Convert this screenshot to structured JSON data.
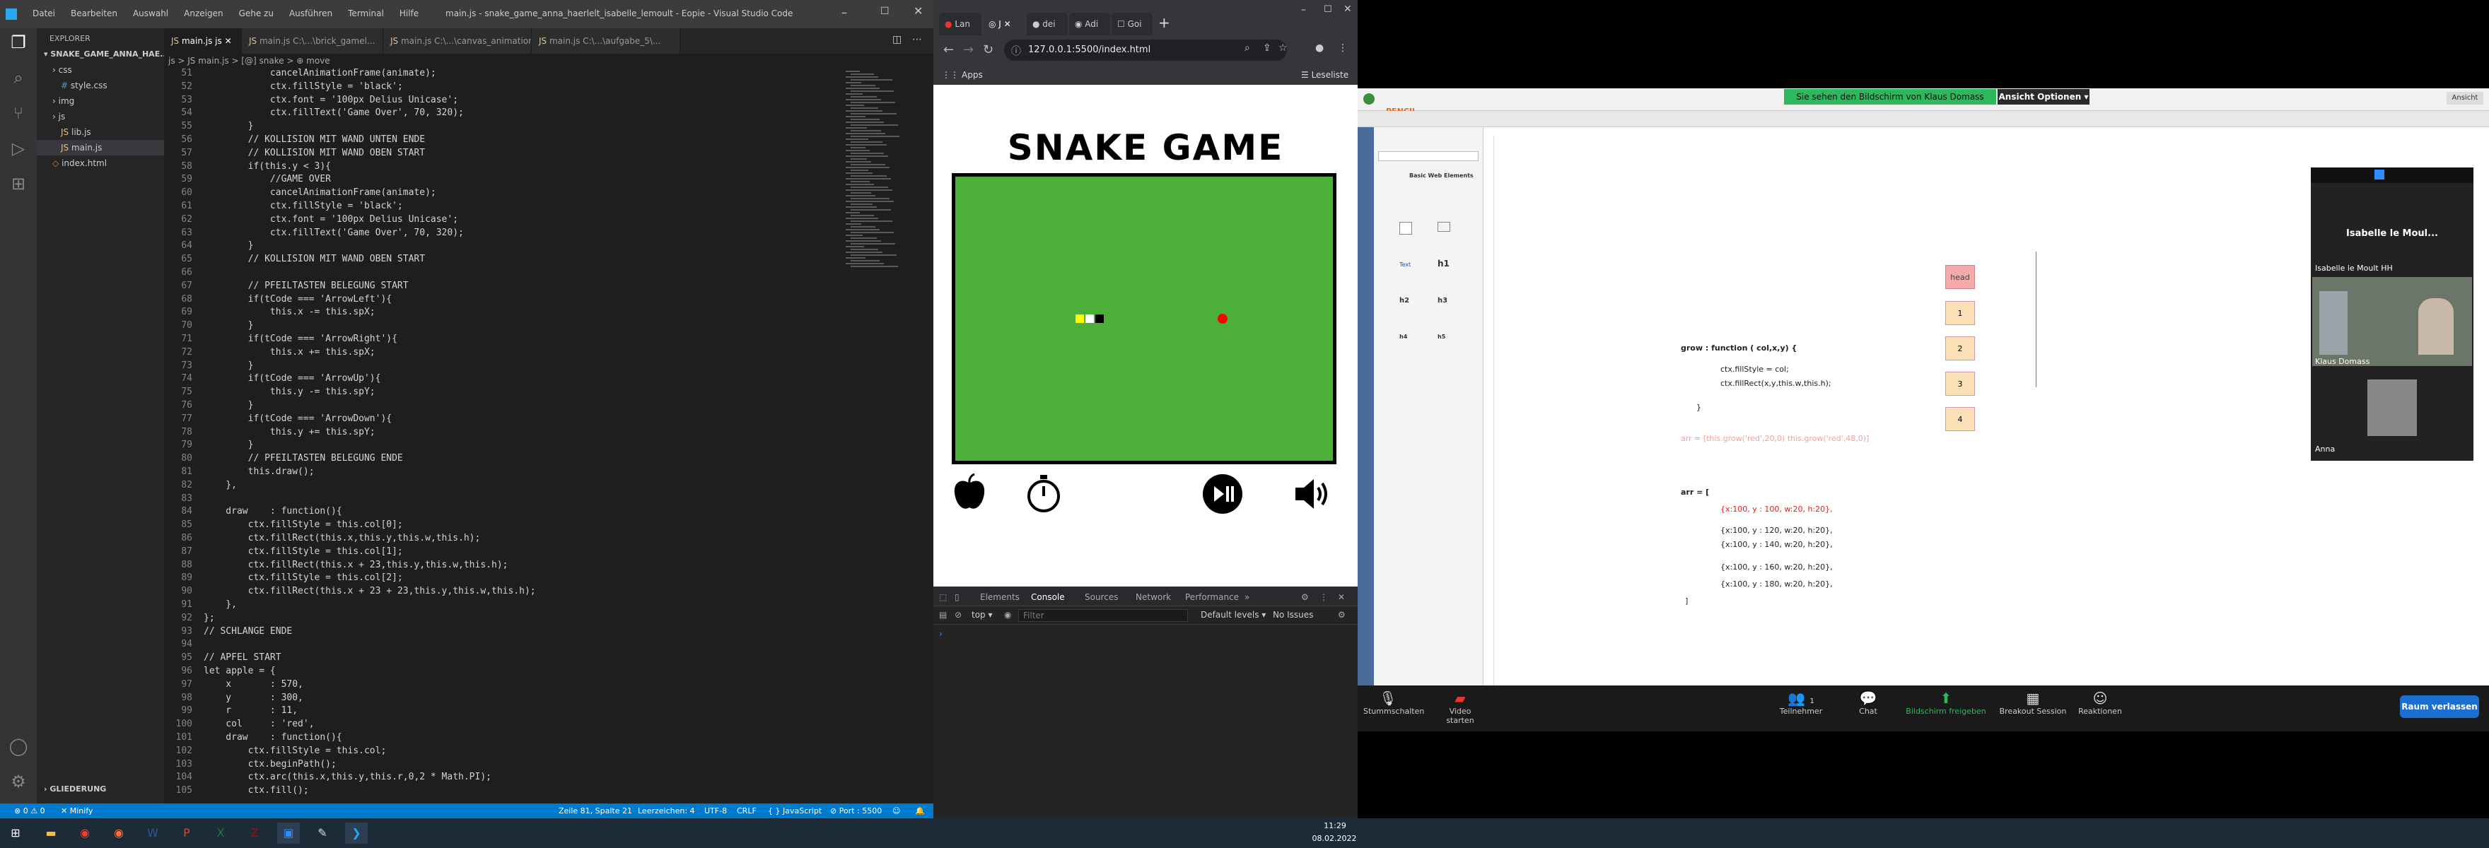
{
  "vscode": {
    "title": "main.js - snake_game_anna_haerlelt_isabelle_lemoult - Eopie - Visual Studio Code",
    "menu": [
      "Datei",
      "Bearbeiten",
      "Auswahl",
      "Anzeigen",
      "Gehe zu",
      "Ausführen",
      "Terminal",
      "Hilfe"
    ],
    "explorer_title": "EXPLORER",
    "project": "SNAKE_GAME_ANNA_HAE...",
    "tree": [
      "css",
      "style.css",
      "img",
      "js",
      "lib.js",
      "main.js",
      "index.html"
    ],
    "outline": "GLIEDERUNG",
    "tabs": [
      "main.js js",
      "main.js C:\\...\\brick_gamel...",
      "main.js C:\\...\\canvas_animation\\...",
      "main.js C:\\...\\aufgabe_5\\..."
    ],
    "breadcrumb": "js > JS main.js > [@] snake > ⊕ move",
    "code": [
      {
        "n": "51",
        "t": "            cancelAnimationFrame(animate);",
        "c": "fn"
      },
      {
        "n": "52",
        "t": "            ctx.fillStyle = 'black';",
        "c": ""
      },
      {
        "n": "53",
        "t": "            ctx.font = '100px Delius Unicase';",
        "c": ""
      },
      {
        "n": "54",
        "t": "            ctx.fillText('Game Over', 70, 320);",
        "c": ""
      },
      {
        "n": "55",
        "t": "        }",
        "c": ""
      },
      {
        "n": "56",
        "t": "        // KOLLISION MIT WAND UNTEN ENDE",
        "c": "cm"
      },
      {
        "n": "57",
        "t": "        // KOLLISION MIT WAND OBEN START",
        "c": "cm"
      },
      {
        "n": "58",
        "t": "        if(this.y < 3){",
        "c": "pp"
      },
      {
        "n": "59",
        "t": "            //GAME OVER",
        "c": "cm"
      },
      {
        "n": "60",
        "t": "            cancelAnimationFrame(animate);",
        "c": "fn"
      },
      {
        "n": "61",
        "t": "            ctx.fillStyle = 'black';",
        "c": ""
      },
      {
        "n": "62",
        "t": "            ctx.font = '100px Delius Unicase';",
        "c": ""
      },
      {
        "n": "63",
        "t": "            ctx.fillText('Game Over', 70, 320);",
        "c": ""
      },
      {
        "n": "64",
        "t": "        }",
        "c": ""
      },
      {
        "n": "65",
        "t": "        // KOLLISION MIT WAND OBEN START",
        "c": "cm"
      },
      {
        "n": "66",
        "t": "",
        "c": ""
      },
      {
        "n": "67",
        "t": "        // PFEILTASTEN BELEGUNG START",
        "c": "cm"
      },
      {
        "n": "68",
        "t": "        if(tCode === 'ArrowLeft'){",
        "c": "pp"
      },
      {
        "n": "69",
        "t": "            this.x -= this.spX;",
        "c": "vr"
      },
      {
        "n": "70",
        "t": "        }",
        "c": ""
      },
      {
        "n": "71",
        "t": "        if(tCode === 'ArrowRight'){",
        "c": "pp"
      },
      {
        "n": "72",
        "t": "            this.x += this.spX;",
        "c": "vr"
      },
      {
        "n": "73",
        "t": "        }",
        "c": ""
      },
      {
        "n": "74",
        "t": "        if(tCode === 'ArrowUp'){",
        "c": "pp"
      },
      {
        "n": "75",
        "t": "            this.y -= this.spY;",
        "c": "vr"
      },
      {
        "n": "76",
        "t": "        }",
        "c": ""
      },
      {
        "n": "77",
        "t": "        if(tCode === 'ArrowDown'){",
        "c": "pp"
      },
      {
        "n": "78",
        "t": "            this.y += this.spY;",
        "c": "vr"
      },
      {
        "n": "79",
        "t": "        }",
        "c": ""
      },
      {
        "n": "80",
        "t": "        // PFEILTASTEN BELEGUNG ENDE",
        "c": "cm"
      },
      {
        "n": "81",
        "t": "        this.draw();",
        "c": "fn"
      },
      {
        "n": "82",
        "t": "    },",
        "c": ""
      },
      {
        "n": "83",
        "t": "",
        "c": ""
      },
      {
        "n": "84",
        "t": "    draw    : function(){",
        "c": "fn"
      },
      {
        "n": "85",
        "t": "        ctx.fillStyle = this.col[0];",
        "c": "vr"
      },
      {
        "n": "86",
        "t": "        ctx.fillRect(this.x,this.y,this.w,this.h);",
        "c": "vr"
      },
      {
        "n": "87",
        "t": "        ctx.fillStyle = this.col[1];",
        "c": "vr"
      },
      {
        "n": "88",
        "t": "        ctx.fillRect(this.x + 23,this.y,this.w,this.h);",
        "c": "vr"
      },
      {
        "n": "89",
        "t": "        ctx.fillStyle = this.col[2];",
        "c": "vr"
      },
      {
        "n": "90",
        "t": "        ctx.fillRect(this.x + 23 + 23,this.y,this.w,this.h);",
        "c": "vr"
      },
      {
        "n": "91",
        "t": "    },",
        "c": ""
      },
      {
        "n": "92",
        "t": "};",
        "c": ""
      },
      {
        "n": "93",
        "t": "// SCHLANGE ENDE",
        "c": "cm"
      },
      {
        "n": "94",
        "t": "",
        "c": ""
      },
      {
        "n": "95",
        "t": "// APFEL START",
        "c": "cm"
      },
      {
        "n": "96",
        "t": "let apple = {",
        "c": "kw"
      },
      {
        "n": "97",
        "t": "    x       : 570,",
        "c": "vr"
      },
      {
        "n": "98",
        "t": "    y       : 300,",
        "c": "vr"
      },
      {
        "n": "99",
        "t": "    r       : 11,",
        "c": "vr"
      },
      {
        "n": "100",
        "t": "    col     : 'red',",
        "c": "vr"
      },
      {
        "n": "101",
        "t": "    draw    : function(){",
        "c": "fn"
      },
      {
        "n": "102",
        "t": "        ctx.fillStyle = this.col;",
        "c": "vr"
      },
      {
        "n": "103",
        "t": "        ctx.beginPath();",
        "c": "fn"
      },
      {
        "n": "104",
        "t": "        ctx.arc(this.x,this.y,this.r,0,2 * Math.PI);",
        "c": "vr"
      },
      {
        "n": "105",
        "t": "        ctx.fill();",
        "c": "fn"
      }
    ],
    "status": {
      "left": "⊗ 0 ⚠ 0",
      "minify": "✕ Minify",
      "pos": "Zeile 81, Spalte 21",
      "spaces": "Leerzeichen: 4",
      "enc": "UTF-8",
      "eol": "CRLF",
      "lang": "{ } JavaScript",
      "port": "⊘ Port : 5500"
    }
  },
  "chrome": {
    "tabs": [
      "Lan",
      "J",
      "dei",
      "Adi",
      "Goi"
    ],
    "url": "127.0.0.1:5500/index.html",
    "apps": "Apps",
    "reading_list": "Leseliste",
    "game_title": "SNAKE GAME",
    "devtools": {
      "tabs": [
        "Elements",
        "Console",
        "Sources",
        "Network",
        "Performance",
        "»"
      ],
      "context": "top",
      "filter_placeholder": "Filter",
      "levels": "Default levels ▾",
      "issues": "No Issues"
    },
    "snake_colors": [
      "#ffff00",
      "#ffffff",
      "#000000"
    ],
    "apple_color": "#ff0000"
  },
  "zoom": {
    "share_banner": "Sie sehen den Bildschirm von Klaus Domass",
    "view_options": "Ansicht Optionen ▾",
    "view_btn": "Ansicht",
    "pencil": "PENCIL",
    "palette_title": "Basic Web Elements",
    "board": {
      "grow_line": "grow :  function ( col,x,y) {",
      "fill_style": "ctx.fillStyle = col;",
      "fill_rect": "ctx.fillRect(x,y,this.w,this.h);",
      "close": "}",
      "arr_pink": "arr = [this.grow('red',20,0) this.grow('red',48,0)]",
      "arr_open": "arr = [",
      "arr_items": [
        "{x:100, y : 100, w:20, h:20},",
        "{x:100, y : 120, w:20, h:20},",
        "{x:100, y : 140, w:20, h:20},",
        "{x:100, y : 160, w:20, h:20},",
        "{x:100, y : 180, w:20, h:20},"
      ],
      "arr_close": "]",
      "boxes": [
        "head",
        "1",
        "2",
        "3",
        "4"
      ]
    },
    "gallery": {
      "active": "Isabelle le Moul...",
      "p1": "Isabelle le Moult HH",
      "p2": "Klaus Domass",
      "p3": "Anna"
    },
    "bottom": [
      "Stummschalten",
      "Video starten",
      "Teilnehmer",
      "Chat",
      "Bildschirm freigeben",
      "Breakout Session",
      "Reaktionen"
    ],
    "participants_count": "1",
    "leave": "Raum verlassen"
  },
  "taskbar": {
    "time": "11:29",
    "date": "08.02.2022"
  }
}
